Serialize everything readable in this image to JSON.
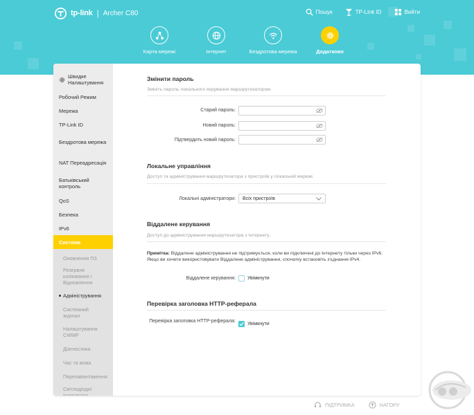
{
  "header": {
    "brand": "tp-link",
    "separator": "|",
    "model": "Archer C80",
    "top_links": [
      {
        "label": "Пошук",
        "icon": "search-icon"
      },
      {
        "label": "TP-Link ID",
        "icon": "user-id-icon"
      },
      {
        "label": "Вийти",
        "icon": "logout-icon"
      }
    ],
    "nav": [
      {
        "label": "Карта мережі",
        "icon": "network-map-icon"
      },
      {
        "label": "Інтернет",
        "icon": "globe-icon"
      },
      {
        "label": "Бездротова мережа",
        "icon": "wifi-icon"
      },
      {
        "label": "Додатково",
        "icon": "gear-icon",
        "active": true
      }
    ],
    "accent_color": "#4acbd6",
    "active_color": "#ffd000"
  },
  "sidebar": {
    "items": [
      {
        "label": "Швидке Налаштування"
      },
      {
        "label": "Робочий Режим"
      },
      {
        "label": "Мережа"
      },
      {
        "label": "TP-Link ID"
      },
      {
        "label": "Бездротова мережа"
      },
      {
        "label": "NAT Переадресація"
      },
      {
        "label": "Батьківський контроль"
      },
      {
        "label": "QoS"
      },
      {
        "label": "Безпека"
      },
      {
        "label": "IPv6"
      },
      {
        "label": "Система"
      }
    ],
    "sub_items": [
      {
        "label": "Оновлення ПЗ"
      },
      {
        "label": "Резервне копіювання і Відновлення"
      },
      {
        "label": "Адміністрування"
      },
      {
        "label": "Системний журнал"
      },
      {
        "label": "Налаштування CWMP"
      },
      {
        "label": "Діагностика"
      },
      {
        "label": "Час та мова"
      },
      {
        "label": "Перезавантаження"
      },
      {
        "label": "Світлодіодні індикатори"
      }
    ]
  },
  "change_password": {
    "title": "Змінити пароль",
    "desc": "Змініть пароль локального керування маршрутизатором.",
    "old_label": "Старий пароль:",
    "new_label": "Новий пароль:",
    "confirm_label": "Підтвердить новий пароль:",
    "old_value": "",
    "new_value": "",
    "confirm_value": ""
  },
  "local_management": {
    "title": "Локальне управління",
    "desc": "Доступ та адміністрування маршрутизатора з пристроїв у локальній мережі.",
    "admins_label": "Локальні адміністратори:",
    "admins_value": "Всіх пристроїв"
  },
  "remote_management": {
    "title": "Віддалене керування",
    "desc": "Доступ до адміністрування маршрутизатора з Інтернету.",
    "note_bold": "Примітка:",
    "note_text": " Віддалене адміністрування не підтримується, коли ви підключені до Інтернету тільки через IPv6. Якщо ви хочете використовувати Віддалене адміністрування, спочатку встановіть з'єднання IPv4.",
    "label": "Віддалене керування:",
    "checkbox_label": "Увімкнути",
    "checked": false
  },
  "http_referer": {
    "title": "Перевірка заголовка HTTP-реферала",
    "label": "Перевірка заголовка HTTP-реферала:",
    "checkbox_label": "Увімкнути",
    "checked": true
  },
  "footer": {
    "support": "ПІДТРИМКА",
    "top": "НАГОРУ"
  }
}
